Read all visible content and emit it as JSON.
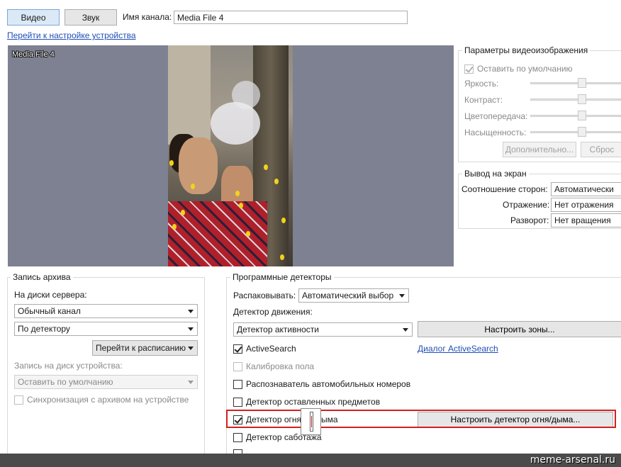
{
  "tabs": {
    "video": "Видео",
    "sound": "Звук"
  },
  "channel": {
    "name_label": "Имя канала:",
    "name_value": "Media File 4"
  },
  "device_settings_link": "Перейти к настройке устройства",
  "preview": {
    "title": "Media File 4"
  },
  "video_params": {
    "title": "Параметры видеоизображения",
    "default_checkbox": "Оставить по умолчанию",
    "brightness": "Яркость:",
    "contrast": "Контраст:",
    "color": "Цветопередача:",
    "saturation": "Насыщенность:",
    "advanced_button": "Дополнительно...",
    "reset_button": "Сброс"
  },
  "display_output": {
    "title": "Вывод на экран",
    "aspect_label": "Соотношение сторон:",
    "aspect_value": "Автоматически",
    "mirror_label": "Отражение:",
    "mirror_value": "Нет отражения",
    "rotation_label": "Разворот:",
    "rotation_value": "Нет вращения"
  },
  "archive": {
    "title": "Запись архива",
    "server_disks_label": "На диски сервера:",
    "channel_type": "Обычный канал",
    "record_mode": "По детектору",
    "schedule_button": "Перейти к расписанию",
    "device_disk_label": "Запись на диск устройства:",
    "device_disk_value": "Оставить по умолчанию",
    "sync_checkbox": "Синхронизация с архивом на устройстве"
  },
  "detectors": {
    "title": "Программные детекторы",
    "unpack_label": "Распаковывать:",
    "unpack_value": "Автоматический выбор",
    "motion_label": "Детектор движения:",
    "motion_value": "Детектор активности",
    "zones_button": "Настроить зоны...",
    "activesearch": "ActiveSearch",
    "activesearch_link": "Диалог ActiveSearch",
    "floor_calibration": "Калибровка пола",
    "plate_recognizer": "Распознаватель автомобильных номеров",
    "left_objects": "Детектор оставленных предметов",
    "fire_smoke_a": "Детектор огня",
    "fire_smoke_b": "ыма",
    "fire_smoke_button": "Настроить детектор огня/дыма...",
    "sabotage": "Детектор саботажа"
  },
  "watermark": "meme-arsenal.ru",
  "colors": {
    "highlight": "#d41f1f",
    "link": "#1f4fb5",
    "video_bg": "#7d8191"
  }
}
